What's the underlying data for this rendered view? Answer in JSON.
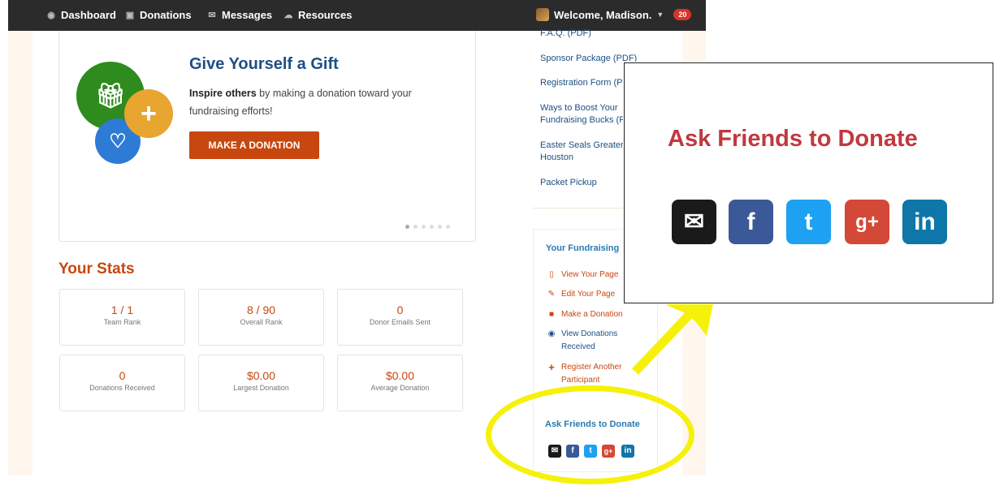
{
  "nav": {
    "items": [
      {
        "label": "Dashboard",
        "icon": "dashboard-icon"
      },
      {
        "label": "Donations",
        "icon": "gift-icon"
      },
      {
        "label": "Messages",
        "icon": "envelope-icon"
      },
      {
        "label": "Resources",
        "icon": "cloud-icon"
      }
    ],
    "welcome": "Welcome, Madison.",
    "badge": "20"
  },
  "carousel": {
    "title": "Give Yourself a Gift",
    "text_bold": "Inspire others",
    "text_rest": " by making a donation toward your fundraising efforts!",
    "button": "MAKE A DONATION",
    "slide_count": 6,
    "active_slide": 1
  },
  "stats": {
    "title": "Your Stats",
    "cards": [
      {
        "value": "1 / 1",
        "label": "Team Rank"
      },
      {
        "value": "8 / 90",
        "label": "Overall Rank"
      },
      {
        "value": "0",
        "label": "Donor Emails Sent"
      },
      {
        "value": "0",
        "label": "Donations Received"
      },
      {
        "value": "$0.00",
        "label": "Largest Donation"
      },
      {
        "value": "$0.00",
        "label": "Average Donation"
      }
    ]
  },
  "resources": {
    "links": [
      "F.A.Q. (PDF)",
      "Sponsor Package (PDF)",
      "Registration Form (P",
      "Ways to Boost Your",
      "Fundraising Bucks (P",
      "Easter Seals Greater",
      "Houston",
      "Packet Pickup"
    ]
  },
  "fundraising": {
    "title": "Your Fundraising",
    "items": [
      {
        "label": "View Your Page",
        "label2": "",
        "icon": "page-icon"
      },
      {
        "label": "Edit Your Page",
        "label2": "",
        "icon": "pencil-icon"
      },
      {
        "label": "Make a Donation",
        "label2": "",
        "icon": "gift-icon"
      },
      {
        "label": "View Donations",
        "label2": "Received",
        "icon": "eye-icon"
      },
      {
        "label": "Register Another",
        "label2": "Participant",
        "icon": "plus-icon"
      }
    ]
  },
  "ask_friends": {
    "title": "Ask Friends to Donate",
    "zoom_title": "Ask Friends to Donate",
    "networks": [
      {
        "label": "✉",
        "icon": "email-icon",
        "color": "#1a1a1a"
      },
      {
        "label": "f",
        "icon": "facebook-icon",
        "color": "#3b5998"
      },
      {
        "label": "t",
        "icon": "twitter-icon",
        "color": "#1da1f2"
      },
      {
        "label": "g+",
        "icon": "google-plus-icon",
        "color": "#d34836"
      },
      {
        "label": "in",
        "icon": "linkedin-icon",
        "color": "#0e76a8"
      }
    ]
  },
  "colors": {
    "accent": "#c8470f",
    "link": "#1e4f84",
    "highlight": "#f5f10a",
    "zoom_title": "#c0393f"
  }
}
